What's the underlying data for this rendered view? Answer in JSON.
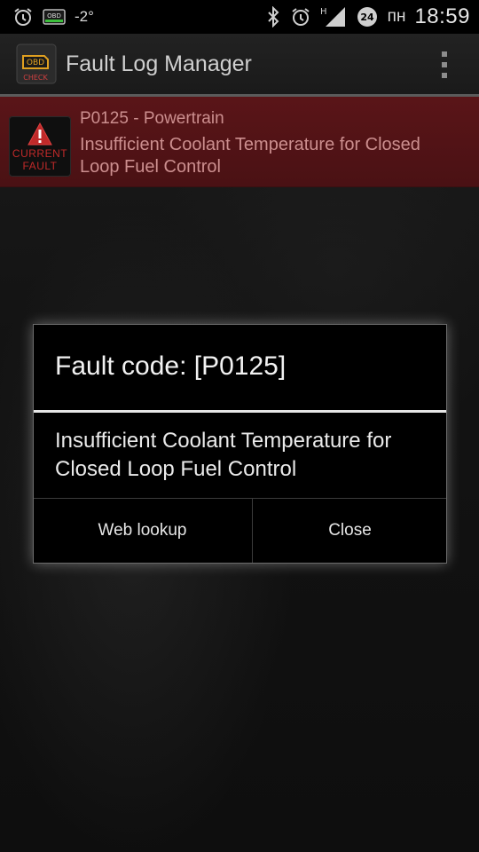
{
  "status_bar": {
    "temperature": "-2°",
    "obd_label": "OBD",
    "network_badge": "24",
    "network_type": "H",
    "day": "пн",
    "time": "18:59",
    "icons": [
      "alarm-icon",
      "obd-icon",
      "bluetooth-icon",
      "alarm-icon",
      "signal-icon",
      "data-badge-icon"
    ]
  },
  "app_bar": {
    "title": "Fault Log Manager",
    "icon": "obd-check-icon",
    "icon_label_top": "OBD",
    "icon_label_bottom": "CHECK"
  },
  "fault_item": {
    "badge_line1": "CURRENT",
    "badge_line2": "FAULT",
    "code": "P0125 - Powertrain",
    "description": "Insufficient Coolant Temperature for Closed Loop Fuel Control"
  },
  "dialog": {
    "title": "Fault code: [P0125]",
    "message": "Insufficient Coolant Temperature for Closed Loop Fuel Control",
    "buttons": {
      "web_lookup": "Web lookup",
      "close": "Close"
    }
  }
}
